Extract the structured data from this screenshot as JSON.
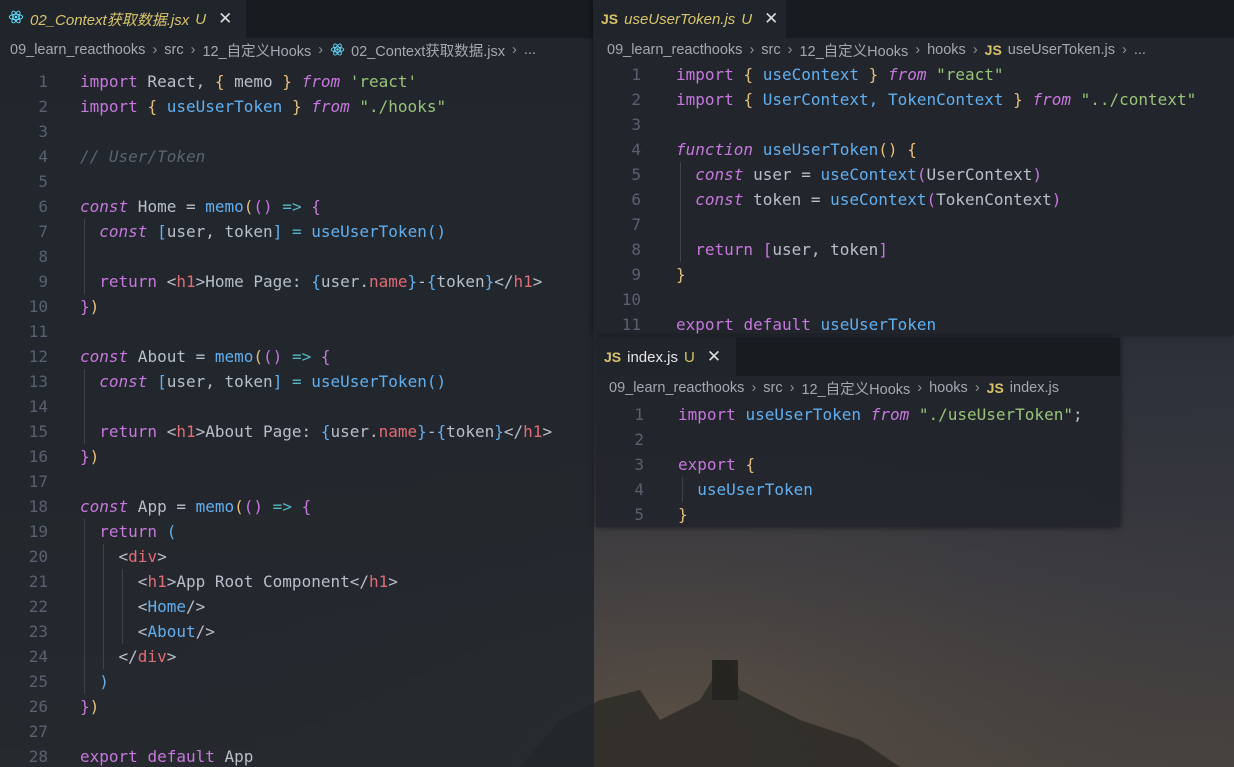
{
  "panels": [
    {
      "id": "p1",
      "tab": {
        "file": "02_Context获取数据.jsx",
        "status": "U",
        "icon": "react-icon",
        "modified": true
      },
      "breadcrumb": [
        "09_learn_reacthooks",
        "src",
        "12_自定义Hooks",
        "02_Context获取数据.jsx",
        "..."
      ],
      "crumb_icons": {
        "3": "react-icon"
      },
      "lines": [
        {
          "n": "1",
          "t": [
            [
              "import",
              "k"
            ],
            [
              " React, ",
              "d"
            ],
            [
              "{",
              "p"
            ],
            [
              " memo ",
              "d"
            ],
            [
              "}",
              "p"
            ],
            [
              " ",
              "d"
            ],
            [
              "from",
              "i"
            ],
            [
              " 'react'",
              "s"
            ]
          ]
        },
        {
          "n": "2",
          "t": [
            [
              "import",
              "k"
            ],
            [
              " ",
              "d"
            ],
            [
              "{",
              "p"
            ],
            [
              " useUserToken ",
              "f"
            ],
            [
              "}",
              "p"
            ],
            [
              " ",
              "d"
            ],
            [
              "from",
              "i"
            ],
            [
              " \"./hooks\"",
              "s"
            ]
          ]
        },
        {
          "n": "3",
          "t": []
        },
        {
          "n": "4",
          "t": [
            [
              "// User/Token",
              "cm"
            ]
          ]
        },
        {
          "n": "5",
          "t": []
        },
        {
          "n": "6",
          "t": [
            [
              "const",
              "i"
            ],
            [
              " Home = ",
              "d"
            ],
            [
              "memo",
              "f"
            ],
            [
              "(",
              "p"
            ],
            [
              "()",
              "pu"
            ],
            [
              " => ",
              "c"
            ],
            [
              "{",
              "pu"
            ]
          ]
        },
        {
          "n": "7",
          "g": [
            1
          ],
          "t": [
            [
              "  ",
              "d"
            ],
            [
              "const",
              "i"
            ],
            [
              " ",
              "d"
            ],
            [
              "[",
              "pb"
            ],
            [
              "user, token",
              "d"
            ],
            [
              "]",
              "pb"
            ],
            [
              " = ",
              "c"
            ],
            [
              "useUserToken",
              "f"
            ],
            [
              "()",
              "pb"
            ]
          ]
        },
        {
          "n": "8",
          "g": [
            1
          ],
          "t": []
        },
        {
          "n": "9",
          "g": [
            1
          ],
          "t": [
            [
              "  ",
              "d"
            ],
            [
              "return",
              "k"
            ],
            [
              " <",
              "d"
            ],
            [
              "h1",
              "t"
            ],
            [
              ">Home Page: ",
              "d"
            ],
            [
              "{",
              "pb"
            ],
            [
              "user.",
              "d"
            ],
            [
              "name",
              "r"
            ],
            [
              "}",
              "pb"
            ],
            [
              "-",
              "d"
            ],
            [
              "{",
              "pb"
            ],
            [
              "token",
              "d"
            ],
            [
              "}",
              "pb"
            ],
            [
              "</",
              "d"
            ],
            [
              "h1",
              "t"
            ],
            [
              ">",
              "d"
            ]
          ]
        },
        {
          "n": "10",
          "t": [
            [
              "}",
              "pu"
            ],
            [
              ")",
              "p"
            ]
          ]
        },
        {
          "n": "11",
          "t": []
        },
        {
          "n": "12",
          "t": [
            [
              "const",
              "i"
            ],
            [
              " About = ",
              "d"
            ],
            [
              "memo",
              "f"
            ],
            [
              "(",
              "p"
            ],
            [
              "()",
              "pu"
            ],
            [
              " => ",
              "c"
            ],
            [
              "{",
              "pu"
            ]
          ]
        },
        {
          "n": "13",
          "g": [
            1
          ],
          "t": [
            [
              "  ",
              "d"
            ],
            [
              "const",
              "i"
            ],
            [
              " ",
              "d"
            ],
            [
              "[",
              "pb"
            ],
            [
              "user, token",
              "d"
            ],
            [
              "]",
              "pb"
            ],
            [
              " = ",
              "c"
            ],
            [
              "useUserToken",
              "f"
            ],
            [
              "()",
              "pb"
            ]
          ]
        },
        {
          "n": "14",
          "g": [
            1
          ],
          "t": []
        },
        {
          "n": "15",
          "g": [
            1
          ],
          "t": [
            [
              "  ",
              "d"
            ],
            [
              "return",
              "k"
            ],
            [
              " <",
              "d"
            ],
            [
              "h1",
              "t"
            ],
            [
              ">About Page: ",
              "d"
            ],
            [
              "{",
              "pb"
            ],
            [
              "user.",
              "d"
            ],
            [
              "name",
              "r"
            ],
            [
              "}",
              "pb"
            ],
            [
              "-",
              "d"
            ],
            [
              "{",
              "pb"
            ],
            [
              "token",
              "d"
            ],
            [
              "}",
              "pb"
            ],
            [
              "</",
              "d"
            ],
            [
              "h1",
              "t"
            ],
            [
              ">",
              "d"
            ]
          ]
        },
        {
          "n": "16",
          "t": [
            [
              "}",
              "pu"
            ],
            [
              ")",
              "p"
            ]
          ]
        },
        {
          "n": "17",
          "t": []
        },
        {
          "n": "18",
          "t": [
            [
              "const",
              "i"
            ],
            [
              " App = ",
              "d"
            ],
            [
              "memo",
              "f"
            ],
            [
              "(",
              "p"
            ],
            [
              "()",
              "pu"
            ],
            [
              " => ",
              "c"
            ],
            [
              "{",
              "pu"
            ]
          ]
        },
        {
          "n": "19",
          "g": [
            1
          ],
          "t": [
            [
              "  ",
              "d"
            ],
            [
              "return",
              "k"
            ],
            [
              " ",
              "d"
            ],
            [
              "(",
              "pb"
            ]
          ]
        },
        {
          "n": "20",
          "g": [
            1,
            3
          ],
          "t": [
            [
              "    <",
              "d"
            ],
            [
              "div",
              "t"
            ],
            [
              ">",
              "d"
            ]
          ]
        },
        {
          "n": "21",
          "g": [
            1,
            3,
            5
          ],
          "t": [
            [
              "      <",
              "d"
            ],
            [
              "h1",
              "t"
            ],
            [
              ">App Root Component</",
              "d"
            ],
            [
              "h1",
              "t"
            ],
            [
              ">",
              "d"
            ]
          ]
        },
        {
          "n": "22",
          "g": [
            1,
            3,
            5
          ],
          "t": [
            [
              "      <",
              "d"
            ],
            [
              "Home",
              "f"
            ],
            [
              "/>",
              "d"
            ]
          ]
        },
        {
          "n": "23",
          "g": [
            1,
            3,
            5
          ],
          "t": [
            [
              "      <",
              "d"
            ],
            [
              "About",
              "f"
            ],
            [
              "/>",
              "d"
            ]
          ]
        },
        {
          "n": "24",
          "g": [
            1,
            3
          ],
          "t": [
            [
              "    </",
              "d"
            ],
            [
              "div",
              "t"
            ],
            [
              ">",
              "d"
            ]
          ]
        },
        {
          "n": "25",
          "g": [
            1
          ],
          "t": [
            [
              "  ",
              "d"
            ],
            [
              ")",
              "pb"
            ]
          ]
        },
        {
          "n": "26",
          "t": [
            [
              "}",
              "pu"
            ],
            [
              ")",
              "p"
            ]
          ]
        },
        {
          "n": "27",
          "t": []
        },
        {
          "n": "28",
          "t": [
            [
              "export",
              "k"
            ],
            [
              " ",
              "d"
            ],
            [
              "default",
              "k"
            ],
            [
              " App",
              "d"
            ]
          ]
        }
      ]
    },
    {
      "id": "p2",
      "tab": {
        "file": "useUserToken.js",
        "status": "U",
        "icon": "js-icon",
        "badge": "JS",
        "modified": true
      },
      "breadcrumb": [
        "09_learn_reacthooks",
        "src",
        "12_自定义Hooks",
        "hooks",
        "useUserToken.js",
        "..."
      ],
      "crumb_icons": {
        "4": "js-icon"
      },
      "lines": [
        {
          "n": "1",
          "t": [
            [
              "import",
              "k"
            ],
            [
              " ",
              "d"
            ],
            [
              "{",
              "p"
            ],
            [
              " useContext ",
              "f"
            ],
            [
              "}",
              "p"
            ],
            [
              " ",
              "d"
            ],
            [
              "from",
              "i"
            ],
            [
              " \"react\"",
              "s"
            ]
          ]
        },
        {
          "n": "2",
          "t": [
            [
              "import",
              "k"
            ],
            [
              " ",
              "d"
            ],
            [
              "{",
              "p"
            ],
            [
              " UserContext, TokenContext ",
              "f"
            ],
            [
              "}",
              "p"
            ],
            [
              " ",
              "d"
            ],
            [
              "from",
              "i"
            ],
            [
              " \"../context\"",
              "s"
            ]
          ]
        },
        {
          "n": "3",
          "t": []
        },
        {
          "n": "4",
          "t": [
            [
              "function",
              "i"
            ],
            [
              " ",
              "d"
            ],
            [
              "useUserToken",
              "f"
            ],
            [
              "()",
              "p"
            ],
            [
              " ",
              "d"
            ],
            [
              "{",
              "p"
            ]
          ]
        },
        {
          "n": "5",
          "g": [
            1
          ],
          "t": [
            [
              "  ",
              "d"
            ],
            [
              "const",
              "i"
            ],
            [
              " user = ",
              "d"
            ],
            [
              "useContext",
              "f"
            ],
            [
              "(",
              "pu"
            ],
            [
              "UserContext",
              "d"
            ],
            [
              ")",
              "pu"
            ]
          ]
        },
        {
          "n": "6",
          "g": [
            1
          ],
          "t": [
            [
              "  ",
              "d"
            ],
            [
              "const",
              "i"
            ],
            [
              " token = ",
              "d"
            ],
            [
              "useContext",
              "f"
            ],
            [
              "(",
              "pu"
            ],
            [
              "TokenContext",
              "d"
            ],
            [
              ")",
              "pu"
            ]
          ]
        },
        {
          "n": "7",
          "g": [
            1
          ],
          "t": []
        },
        {
          "n": "8",
          "g": [
            1
          ],
          "t": [
            [
              "  ",
              "d"
            ],
            [
              "return",
              "k"
            ],
            [
              " ",
              "d"
            ],
            [
              "[",
              "pu"
            ],
            [
              "user, token",
              "d"
            ],
            [
              "]",
              "pu"
            ]
          ]
        },
        {
          "n": "9",
          "t": [
            [
              "}",
              "p"
            ]
          ]
        },
        {
          "n": "10",
          "t": []
        },
        {
          "n": "11",
          "t": [
            [
              "export",
              "k"
            ],
            [
              " ",
              "d"
            ],
            [
              "default",
              "k"
            ],
            [
              " ",
              "d"
            ],
            [
              "useUserToken",
              "f"
            ]
          ]
        }
      ]
    },
    {
      "id": "p3",
      "tab": {
        "file": "index.js",
        "status": "U",
        "icon": "js-icon",
        "badge": "JS",
        "modified": false
      },
      "breadcrumb": [
        "09_learn_reacthooks",
        "src",
        "12_自定义Hooks",
        "hooks",
        "index.js"
      ],
      "crumb_icons": {
        "4": "js-icon"
      },
      "lines": [
        {
          "n": "1",
          "t": [
            [
              "import",
              "k"
            ],
            [
              " ",
              "d"
            ],
            [
              "useUserToken",
              "f"
            ],
            [
              " ",
              "d"
            ],
            [
              "from",
              "i"
            ],
            [
              " \"./useUserToken\"",
              "s"
            ],
            [
              ";",
              "d"
            ]
          ]
        },
        {
          "n": "2",
          "t": []
        },
        {
          "n": "3",
          "t": [
            [
              "export",
              "k"
            ],
            [
              " ",
              "d"
            ],
            [
              "{",
              "p"
            ]
          ]
        },
        {
          "n": "4",
          "g": [
            1
          ],
          "t": [
            [
              "  ",
              "d"
            ],
            [
              "useUserToken",
              "f"
            ]
          ]
        },
        {
          "n": "5",
          "t": [
            [
              "}",
              "p"
            ]
          ]
        }
      ]
    }
  ],
  "colors": {
    "accent_modified": "#d8c46c",
    "react_icon": "#61dafb",
    "js_badge": "#d8c26a",
    "editor_bg": "#21252b"
  }
}
